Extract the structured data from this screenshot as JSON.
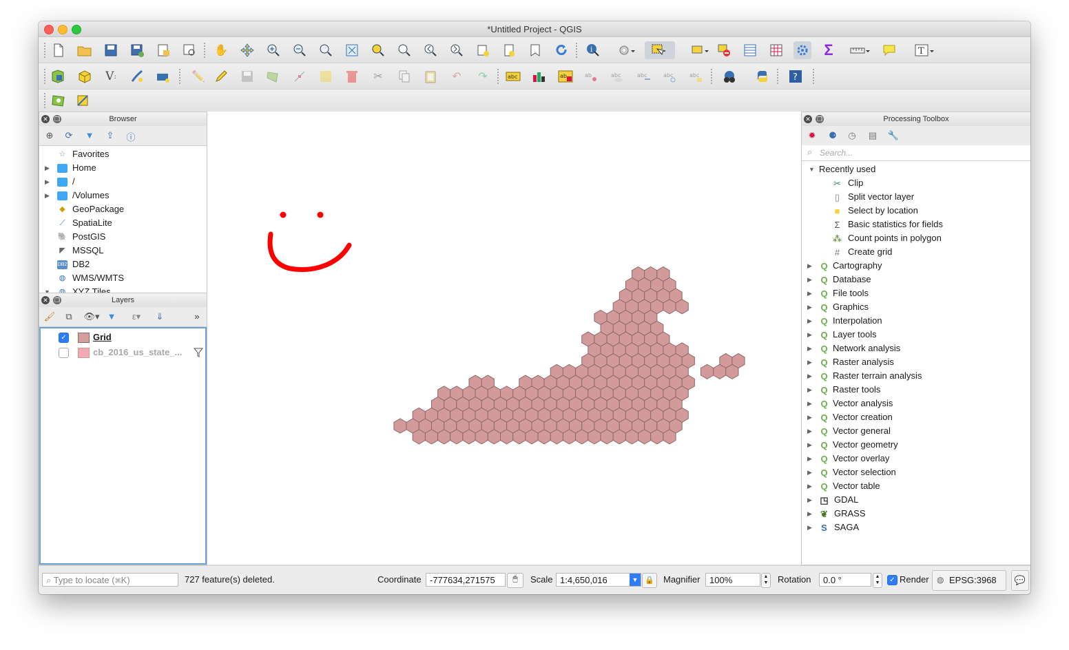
{
  "window": {
    "title": "*Untitled Project - QGIS"
  },
  "browser": {
    "title": "Browser",
    "items": [
      {
        "label": "Favorites",
        "icon": "star-icon",
        "expandable": false
      },
      {
        "label": "Home",
        "icon": "folder-icon",
        "expandable": true
      },
      {
        "label": "/",
        "icon": "folder-icon",
        "expandable": true
      },
      {
        "label": "/Volumes",
        "icon": "folder-icon",
        "expandable": true
      },
      {
        "label": "GeoPackage",
        "icon": "geopackage-icon",
        "expandable": false
      },
      {
        "label": "SpatiaLite",
        "icon": "spatialite-icon",
        "expandable": false
      },
      {
        "label": "PostGIS",
        "icon": "postgis-icon",
        "expandable": false
      },
      {
        "label": "MSSQL",
        "icon": "mssql-icon",
        "expandable": false
      },
      {
        "label": "DB2",
        "icon": "db2-icon",
        "expandable": false
      },
      {
        "label": "WMS/WMTS",
        "icon": "globe-icon",
        "expandable": false
      },
      {
        "label": "XYZ Tiles",
        "icon": "globe-icon",
        "expandable": true
      }
    ],
    "db2_badge": "DB2"
  },
  "layers": {
    "title": "Layers",
    "items": [
      {
        "label": "Grid",
        "checked": true,
        "color": "#d59c9c"
      },
      {
        "label": "cb_2016_us_state_...",
        "checked": false,
        "color": "#f3a9b3"
      }
    ]
  },
  "toolbox": {
    "title": "Processing Toolbox",
    "search_placeholder": "Search...",
    "recently_used_label": "Recently used",
    "recent": [
      {
        "label": "Clip",
        "icon": "clip-icon"
      },
      {
        "label": "Split vector layer",
        "icon": "split-layer-icon"
      },
      {
        "label": "Select by location",
        "icon": "select-location-icon"
      },
      {
        "label": "Basic statistics for fields",
        "icon": "sigma-icon"
      },
      {
        "label": "Count points in polygon",
        "icon": "count-points-icon"
      },
      {
        "label": "Create grid",
        "icon": "grid-icon"
      }
    ],
    "groups": [
      "Cartography",
      "Database",
      "File tools",
      "Graphics",
      "Interpolation",
      "Layer tools",
      "Network analysis",
      "Raster analysis",
      "Raster terrain analysis",
      "Raster tools",
      "Vector analysis",
      "Vector creation",
      "Vector general",
      "Vector geometry",
      "Vector overlay",
      "Vector selection",
      "Vector table"
    ],
    "providers": [
      {
        "label": "GDAL",
        "icon": "gdal-icon"
      },
      {
        "label": "GRASS",
        "icon": "grass-icon"
      },
      {
        "label": "SAGA",
        "icon": "saga-icon"
      }
    ]
  },
  "status": {
    "locate_placeholder": "Type to locate (⌘K)",
    "message": "727 feature(s) deleted.",
    "coordinate_label": "Coordinate",
    "coordinate_value": "-777634,271575",
    "scale_label": "Scale",
    "scale_value": "1:4,650,016",
    "magnifier_label": "Magnifier",
    "magnifier_value": "100%",
    "rotation_label": "Rotation",
    "rotation_value": "0.0 °",
    "render_label": "Render",
    "render_checked": true,
    "crs": "EPSG:3968"
  },
  "map": {
    "hex_fill": "#d29a9a",
    "hex_stroke": "#8c6a6a",
    "sketch_color": "#ff0000"
  }
}
